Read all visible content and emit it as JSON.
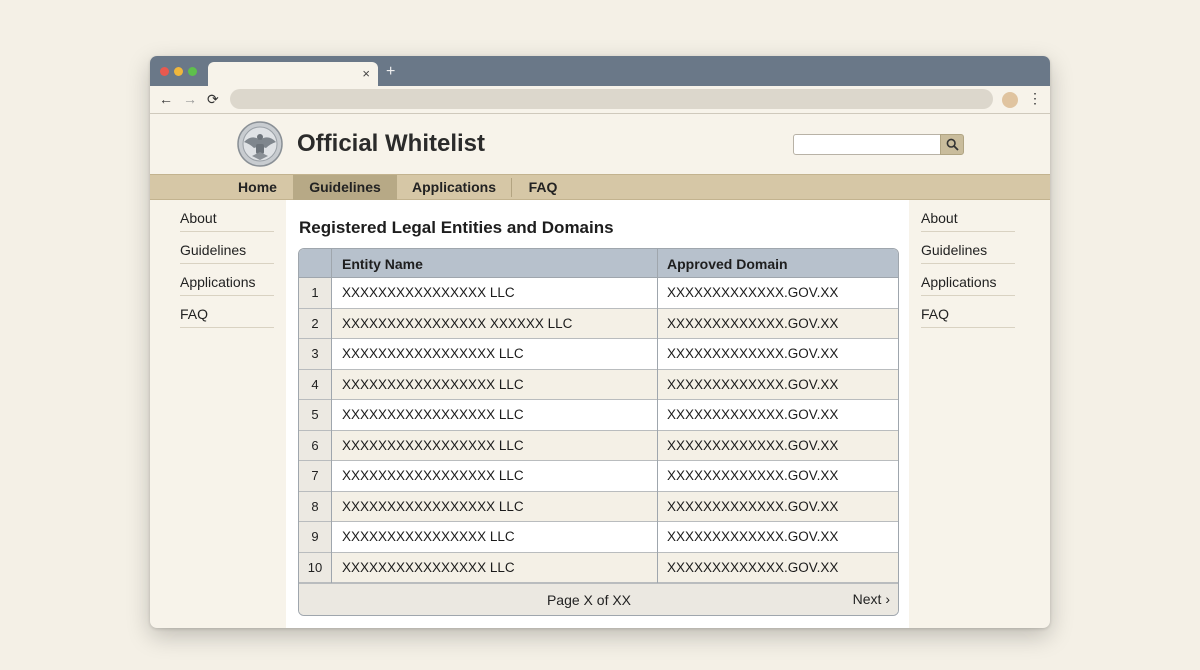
{
  "browser": {
    "tab_close_glyph": "×",
    "new_tab_glyph": "+",
    "back_glyph": "←",
    "forward_glyph": "→",
    "reload_glyph": "⟳",
    "menu_glyph": "⋮"
  },
  "site": {
    "title": "Official Whitelist",
    "search_placeholder": "",
    "seal_icon": "eagle-seal-icon"
  },
  "topnav": {
    "items": [
      {
        "label": "Home",
        "active": false
      },
      {
        "label": "Guidelines",
        "active": true
      },
      {
        "label": "Applications",
        "active": false
      },
      {
        "label": "FAQ",
        "active": false
      }
    ]
  },
  "sidebar_left": {
    "items": [
      "About",
      "Guidelines",
      "Applications",
      "FAQ"
    ]
  },
  "sidebar_right": {
    "items": [
      "About",
      "Guidelines",
      "Applications",
      "FAQ"
    ]
  },
  "main": {
    "title": "Registered Legal Entities and Domains",
    "table": {
      "columns": [
        "",
        "Entity Name",
        "Approved Domain"
      ],
      "rows": [
        {
          "num": "1",
          "name": "XXXXXXXXXXXXXXXX LLC",
          "domain": "XXXXXXXXXXXXX.GOV.XX"
        },
        {
          "num": "2",
          "name": "XXXXXXXXXXXXXXXX XXXXXX LLC",
          "domain": "XXXXXXXXXXXXX.GOV.XX"
        },
        {
          "num": "3",
          "name": "XXXXXXXXXXXXXXXXX LLC",
          "domain": "XXXXXXXXXXXXX.GOV.XX"
        },
        {
          "num": "4",
          "name": "XXXXXXXXXXXXXXXXX LLC",
          "domain": "XXXXXXXXXXXXX.GOV.XX"
        },
        {
          "num": "5",
          "name": "XXXXXXXXXXXXXXXXX LLC",
          "domain": "XXXXXXXXXXXXX.GOV.XX"
        },
        {
          "num": "6",
          "name": "XXXXXXXXXXXXXXXXX LLC",
          "domain": "XXXXXXXXXXXXX.GOV.XX"
        },
        {
          "num": "7",
          "name": "XXXXXXXXXXXXXXXXX LLC",
          "domain": "XXXXXXXXXXXXX.GOV.XX"
        },
        {
          "num": "8",
          "name": "XXXXXXXXXXXXXXXXX LLC",
          "domain": "XXXXXXXXXXXXX.GOV.XX"
        },
        {
          "num": "9",
          "name": "XXXXXXXXXXXXXXXX LLC",
          "domain": "XXXXXXXXXXXXX.GOV.XX"
        },
        {
          "num": "10",
          "name": "XXXXXXXXXXXXXXXX LLC",
          "domain": "XXXXXXXXXXXXX.GOV.XX"
        }
      ]
    },
    "pagination": {
      "page_info": "Page X of XX",
      "next_label": "Next ›"
    }
  },
  "colors": {
    "page_bg": "#f4f0e6",
    "titlebar": "#6a7888",
    "nav_bar": "#d6c7a6",
    "nav_active": "#b7a986",
    "table_header": "#b7c1cc"
  }
}
